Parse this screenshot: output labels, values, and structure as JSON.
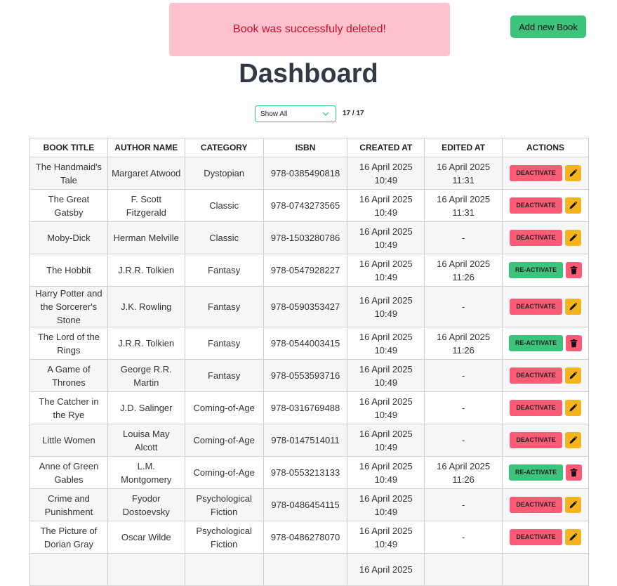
{
  "toast": {
    "message": "Book was successfuly deleted!"
  },
  "toolbar": {
    "add_label": "Add new Book"
  },
  "page": {
    "title": "Dashboard"
  },
  "filter": {
    "selected": "Show All",
    "count": "17 / 17"
  },
  "table": {
    "headers": [
      "BOOK TITLE",
      "AUTHOR NAME",
      "CATEGORY",
      "ISBN",
      "CREATED AT",
      "EDITED AT",
      "ACTIONS"
    ],
    "rows": [
      {
        "title": "The Handmaid's Tale",
        "author": "Margaret Atwood",
        "category": "Dystopian",
        "isbn": "978-0385490818",
        "created": "16 April 2025 10:49",
        "edited": "16 April 2025 11:31",
        "status": "DEACTIVATE"
      },
      {
        "title": "The Great Gatsby",
        "author": "F. Scott Fitzgerald",
        "category": "Classic",
        "isbn": "978-0743273565",
        "created": "16 April 2025 10:49",
        "edited": "16 April 2025 11:31",
        "status": "DEACTIVATE"
      },
      {
        "title": "Moby-Dick",
        "author": "Herman Melville",
        "category": "Classic",
        "isbn": "978-1503280786",
        "created": "16 April 2025 10:49",
        "edited": "-",
        "status": "DEACTIVATE"
      },
      {
        "title": "The Hobbit",
        "author": "J.R.R. Tolkien",
        "category": "Fantasy",
        "isbn": "978-0547928227",
        "created": "16 April 2025 10:49",
        "edited": "16 April 2025 11:26",
        "status": "RE-ACTIVATE"
      },
      {
        "title": "Harry Potter and the Sorcerer's Stone",
        "author": "J.K. Rowling",
        "category": "Fantasy",
        "isbn": "978-0590353427",
        "created": "16 April 2025 10:49",
        "edited": "-",
        "status": "DEACTIVATE"
      },
      {
        "title": "The Lord of the Rings",
        "author": "J.R.R. Tolkien",
        "category": "Fantasy",
        "isbn": "978-0544003415",
        "created": "16 April 2025 10:49",
        "edited": "16 April 2025 11:26",
        "status": "RE-ACTIVATE"
      },
      {
        "title": "A Game of Thrones",
        "author": "George R.R. Martin",
        "category": "Fantasy",
        "isbn": "978-0553593716",
        "created": "16 April 2025 10:49",
        "edited": "-",
        "status": "DEACTIVATE"
      },
      {
        "title": "The Catcher in the Rye",
        "author": "J.D. Salinger",
        "category": "Coming-of-Age",
        "isbn": "978-0316769488",
        "created": "16 April 2025 10:49",
        "edited": "-",
        "status": "DEACTIVATE"
      },
      {
        "title": "Little Women",
        "author": "Louisa May Alcott",
        "category": "Coming-of-Age",
        "isbn": "978-0147514011",
        "created": "16 April 2025 10:49",
        "edited": "-",
        "status": "DEACTIVATE"
      },
      {
        "title": "Anne of Green Gables",
        "author": "L.M. Montgomery",
        "category": "Coming-of-Age",
        "isbn": "978-0553213133",
        "created": "16 April 2025 10:49",
        "edited": "16 April 2025 11:26",
        "status": "RE-ACTIVATE"
      },
      {
        "title": "Crime and Punishment",
        "author": "Fyodor Dostoevsky",
        "category": "Psychological Fiction",
        "isbn": "978-0486454115",
        "created": "16 April 2025 10:49",
        "edited": "-",
        "status": "DEACTIVATE"
      },
      {
        "title": "The Picture of Dorian Gray",
        "author": "Oscar Wilde",
        "category": "Psychological Fiction",
        "isbn": "978-0486278070",
        "created": "16 April 2025 10:49",
        "edited": "-",
        "status": "DEACTIVATE"
      },
      {
        "title": "",
        "author": "",
        "category": "",
        "isbn": "",
        "created": "16 April 2025",
        "edited": "",
        "status": ""
      }
    ]
  },
  "colors": {
    "accent": "#3cc47c",
    "danger": "#ff5a76",
    "warning": "#f5b320",
    "toast_bg": "#ffc1cc",
    "toast_text": "#c8102e"
  },
  "icons": {
    "edit": "pencil-icon",
    "delete": "trash-icon",
    "dropdown": "chevron-down-icon"
  }
}
